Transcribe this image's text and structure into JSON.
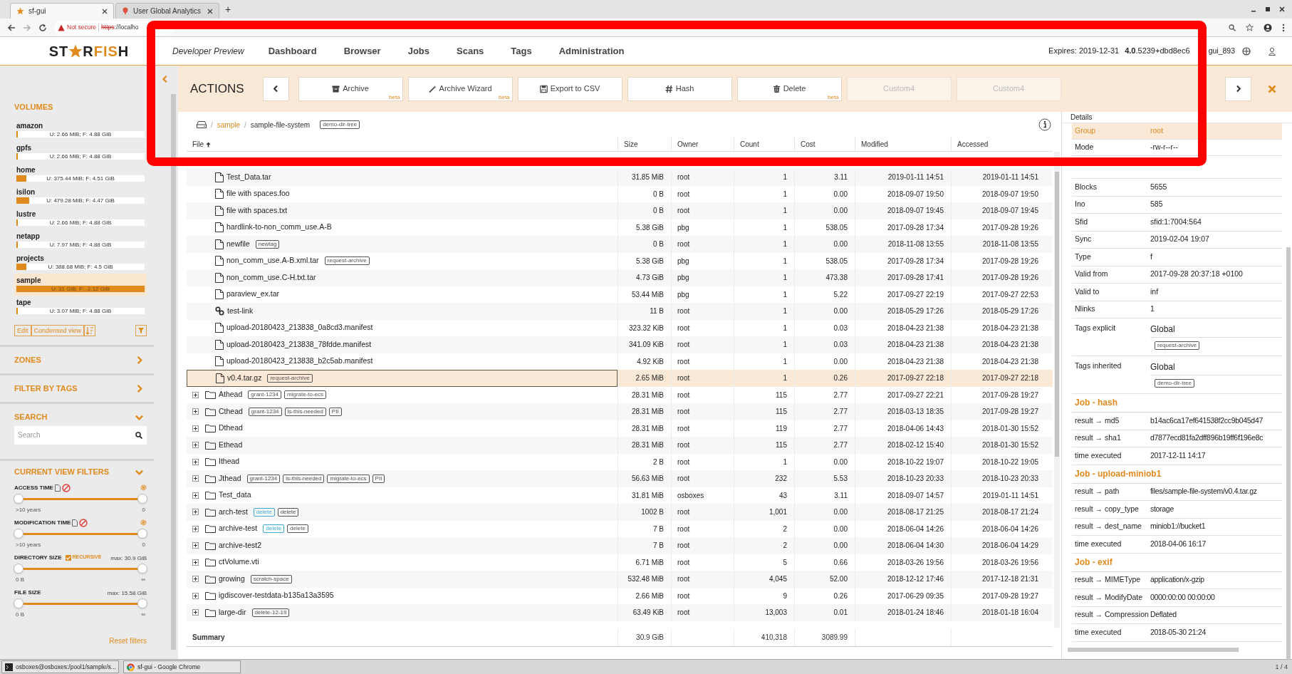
{
  "browser": {
    "tabs": [
      {
        "title": "sf-gui",
        "selected": true
      },
      {
        "title": "User Global Analytics",
        "selected": false
      }
    ],
    "new_tab": "+",
    "address": {
      "security": "Not secure",
      "scheme": "https",
      "rest": "://localho"
    }
  },
  "header": {
    "logo": {
      "before": "ST",
      "after": [
        {
          "text": "R",
          "accent": false
        },
        {
          "text": "FIS",
          "accent": true
        },
        {
          "text": "H",
          "accent": false
        }
      ]
    },
    "preview": "Developer Preview",
    "nav": [
      "Dashboard",
      "Browser",
      "Jobs",
      "Scans",
      "Tags",
      "Administration"
    ],
    "expires": "Expires: 2019-12-31",
    "version": "**4.0**.5239+dbd8ec6",
    "build": "gui_893"
  },
  "sidebar": {
    "volumes_title": "VOLUMES",
    "volumes": [
      {
        "name": "amazon",
        "usage": "U: 2.66 MiB; F: 4.88 GiB",
        "level": 0.005,
        "selected": false
      },
      {
        "name": "gpfs",
        "usage": "U: 2.66 MiB; F: 4.88 GiB",
        "level": 0.005,
        "selected": false
      },
      {
        "name": "home",
        "usage": "U: 375.44 MiB; F: 4.51 GiB",
        "level": 0.08,
        "selected": false
      },
      {
        "name": "isilon",
        "usage": "U: 479.28 MiB; F: 4.47 GiB",
        "level": 0.1,
        "selected": false
      },
      {
        "name": "lustre",
        "usage": "U: 2.66 MiB; F: 4.88 GiB",
        "level": 0.005,
        "selected": false
      },
      {
        "name": "netapp",
        "usage": "U: 7.97 MiB; F: 4.88 GiB",
        "level": 0.005,
        "selected": false
      },
      {
        "name": "projects",
        "usage": "U: 388.68 MiB; F: 4.5 GiB",
        "level": 0.08,
        "selected": false
      },
      {
        "name": "sample",
        "usage": "U: 31 GiB; F: -2.12 GiB",
        "level": 1,
        "selected": true
      },
      {
        "name": "tape",
        "usage": "U: 3.07 MiB; F: 4.88 GiB",
        "level": 0.005,
        "selected": false
      }
    ],
    "volume_buttons": [
      "Edit",
      "Condensed view"
    ],
    "sections": [
      {
        "title": "ZONES",
        "expanded": false
      },
      {
        "title": "FILTER BY TAGS",
        "expanded": false
      },
      {
        "title": "SEARCH",
        "expanded": true
      }
    ],
    "search": {
      "placeholder": "Search"
    },
    "filters_title": "CURRENT VIEW FILTERS",
    "filters_expanded": true,
    "filters": [
      {
        "kind": "time",
        "label": "ACCESS TIME",
        "level": 1,
        "min": ">10 years",
        "max": "0"
      },
      {
        "kind": "time",
        "label": "MODIFICATION TIME",
        "level": 1,
        "min": ">10 years",
        "max": "0"
      },
      {
        "kind": "size",
        "label": "DIRECTORY SIZE",
        "recursive": {
          "label": "RECURSIVE",
          "checked": true
        },
        "limit": "max: 30.9 GiB",
        "level": 1,
        "min": "0 B",
        "max": "∞"
      },
      {
        "kind": "size",
        "label": "FILE SIZE",
        "limit": "max: 15.58 GiB",
        "level": 1,
        "min": "0 B",
        "max": "∞"
      }
    ],
    "reset": "Reset filters"
  },
  "actions": {
    "title": "ACTIONS",
    "buttons": [
      {
        "kind": "archive",
        "label": "Archive",
        "badge": "beta",
        "disabled": false
      },
      {
        "kind": "wizard",
        "label": "Archive Wizard",
        "badge": "beta",
        "disabled": false
      },
      {
        "kind": "export",
        "label": "Export to CSV",
        "disabled": false
      },
      {
        "kind": "hash",
        "label": "Hash",
        "disabled": false
      },
      {
        "kind": "delete",
        "label": "Delete",
        "badge": "beta",
        "disabled": false
      },
      {
        "kind": "custom",
        "label": "Custom4",
        "disabled": true
      },
      {
        "kind": "custom",
        "label": "Custom4",
        "disabled": true
      }
    ]
  },
  "breadcrumb": {
    "sep": "/",
    "link": "sample",
    "current": "sample-file-system",
    "tag": "demo-dir-tree"
  },
  "table": {
    "columns": [
      "File",
      "Size",
      "Owner",
      "Count",
      "Cost",
      "Modified",
      "Accessed"
    ],
    "rows": [
      {
        "kind": "file",
        "name": "Test_Data.tar",
        "tags": [],
        "size": "31.85 MiB",
        "owner": "root",
        "count": "1",
        "cost": "3.11",
        "modified": "2019-01-11 14:51",
        "accessed": "2019-01-11 14:51",
        "selected": false
      },
      {
        "kind": "file",
        "name": "file with spaces.foo",
        "tags": [],
        "size": "0 B",
        "owner": "root",
        "count": "1",
        "cost": "0.00",
        "modified": "2018-09-07 19:50",
        "accessed": "2018-09-07 19:50",
        "selected": false
      },
      {
        "kind": "file",
        "name": "file with spaces.txt",
        "tags": [],
        "size": "0 B",
        "owner": "root",
        "count": "1",
        "cost": "0.00",
        "modified": "2018-09-07 19:45",
        "accessed": "2018-09-07 19:45",
        "selected": false
      },
      {
        "kind": "file",
        "name": "hardlink-to-non_comm_use.A-B",
        "tags": [],
        "size": "5.38 GiB",
        "owner": "pbg",
        "count": "1",
        "cost": "538.05",
        "modified": "2017-09-28 17:34",
        "accessed": "2017-09-28 19:26",
        "selected": false
      },
      {
        "kind": "file",
        "name": "newfile",
        "tags": [
          {
            "label": "newtag",
            "color": "#555555"
          }
        ],
        "size": "0 B",
        "owner": "root",
        "count": "1",
        "cost": "0.00",
        "modified": "2018-11-08 13:55",
        "accessed": "2018-11-08 13:55",
        "selected": false
      },
      {
        "kind": "file",
        "name": "non_comm_use.A-B.xml.tar",
        "tags": [
          {
            "label": "request-archive",
            "color": "#555555"
          }
        ],
        "size": "5.38 GiB",
        "owner": "pbg",
        "count": "1",
        "cost": "538.05",
        "modified": "2017-09-28 17:34",
        "accessed": "2017-09-28 19:26",
        "selected": false
      },
      {
        "kind": "file",
        "name": "non_comm_use.C-H.txt.tar",
        "tags": [],
        "size": "4.73 GiB",
        "owner": "pbg",
        "count": "1",
        "cost": "473.38",
        "modified": "2017-09-28 17:41",
        "accessed": "2017-09-28 19:26",
        "selected": false
      },
      {
        "kind": "file",
        "name": "paraview_ex.tar",
        "tags": [],
        "size": "53.44 MiB",
        "owner": "pbg",
        "count": "1",
        "cost": "5.22",
        "modified": "2017-09-27 22:19",
        "accessed": "2017-09-27 22:53",
        "selected": false
      },
      {
        "kind": "link",
        "name": "test-link",
        "tags": [],
        "size": "11 B",
        "owner": "root",
        "count": "1",
        "cost": "0.00",
        "modified": "2018-05-29 17:26",
        "accessed": "2018-05-29 17:26",
        "selected": false
      },
      {
        "kind": "file",
        "name": "upload-20180423_213838_0a8cd3.manifest",
        "tags": [],
        "size": "323.32 KiB",
        "owner": "root",
        "count": "1",
        "cost": "0.03",
        "modified": "2018-04-23 21:38",
        "accessed": "2018-04-23 21:38",
        "selected": false
      },
      {
        "kind": "file",
        "name": "upload-20180423_213838_78fdde.manifest",
        "tags": [],
        "size": "341.09 KiB",
        "owner": "root",
        "count": "1",
        "cost": "0.03",
        "modified": "2018-04-23 21:38",
        "accessed": "2018-04-23 21:38",
        "selected": false
      },
      {
        "kind": "file",
        "name": "upload-20180423_213838_b2c5ab.manifest",
        "tags": [],
        "size": "4.92 KiB",
        "owner": "root",
        "count": "1",
        "cost": "0.00",
        "modified": "2018-04-23 21:38",
        "accessed": "2018-04-23 21:38",
        "selected": false
      },
      {
        "kind": "file",
        "name": "v0.4.tar.gz",
        "tags": [
          {
            "label": "request-archive",
            "color": "#555555"
          }
        ],
        "size": "2.65 MiB",
        "owner": "root",
        "count": "1",
        "cost": "0.26",
        "modified": "2017-09-27 22:18",
        "accessed": "2017-09-27 22:18",
        "selected": true
      },
      {
        "kind": "folder",
        "name": "Athead",
        "tags": [
          {
            "label": "grant-1234",
            "color": "#555555"
          },
          {
            "label": "migrate-to-ecs",
            "color": "#555555"
          }
        ],
        "size": "28.31 MiB",
        "owner": "root",
        "count": "115",
        "cost": "2.77",
        "modified": "2017-09-27 22:21",
        "accessed": "2017-09-28 19:27",
        "selected": false
      },
      {
        "kind": "folder",
        "name": "Cthead",
        "tags": [
          {
            "label": "grant-1234",
            "color": "#555555"
          },
          {
            "label": "is-this-needed",
            "color": "#555555"
          },
          {
            "label": "PII",
            "color": "#555555"
          }
        ],
        "size": "28.31 MiB",
        "owner": "root",
        "count": "115",
        "cost": "2.77",
        "modified": "2018-03-13 18:35",
        "accessed": "2017-09-28 19:27",
        "selected": false
      },
      {
        "kind": "folder",
        "name": "Dthead",
        "tags": [],
        "size": "28.31 MiB",
        "owner": "root",
        "count": "119",
        "cost": "2.77",
        "modified": "2018-04-06 14:43",
        "accessed": "2018-01-30 15:52",
        "selected": false
      },
      {
        "kind": "folder",
        "name": "Ethead",
        "tags": [],
        "size": "28.31 MiB",
        "owner": "root",
        "count": "115",
        "cost": "2.77",
        "modified": "2018-02-12 15:40",
        "accessed": "2018-01-30 15:52",
        "selected": false
      },
      {
        "kind": "folder",
        "name": "Ithead",
        "tags": [],
        "size": "2 B",
        "owner": "root",
        "count": "1",
        "cost": "0.00",
        "modified": "2018-10-22 19:07",
        "accessed": "2018-10-22 19:05",
        "selected": false
      },
      {
        "kind": "folder",
        "name": "Jthead",
        "tags": [
          {
            "label": "grant-1234",
            "color": "#555555"
          },
          {
            "label": "is-this-needed",
            "color": "#555555"
          },
          {
            "label": "migrate-to-ecs",
            "color": "#555555"
          },
          {
            "label": "PII",
            "color": "#555555"
          }
        ],
        "size": "56.63 MiB",
        "owner": "root",
        "count": "232",
        "cost": "5.53",
        "modified": "2018-10-23 20:33",
        "accessed": "2018-10-23 20:33",
        "selected": false
      },
      {
        "kind": "folder",
        "name": "Test_data",
        "tags": [],
        "size": "31.81 MiB",
        "owner": "osboxes",
        "count": "43",
        "cost": "3.11",
        "modified": "2018-09-07 14:57",
        "accessed": "2019-01-11 14:51",
        "selected": false
      },
      {
        "kind": "folder",
        "name": "arch-test",
        "tags": [
          {
            "label": "delete",
            "color": "#3fa9d5"
          },
          {
            "label": "delete",
            "color": "#555555"
          }
        ],
        "size": "1002 B",
        "owner": "root",
        "count": "1,001",
        "cost": "0.00",
        "modified": "2018-08-17 21:25",
        "accessed": "2018-08-17 21:24",
        "selected": false
      },
      {
        "kind": "folder",
        "name": "archive-test",
        "tags": [
          {
            "label": "delete",
            "color": "#3fa9d5"
          },
          {
            "label": "delete",
            "color": "#555555"
          }
        ],
        "size": "7 B",
        "owner": "root",
        "count": "2",
        "cost": "0.00",
        "modified": "2018-06-04 14:26",
        "accessed": "2018-06-04 14:26",
        "selected": false
      },
      {
        "kind": "folder",
        "name": "archive-test2",
        "tags": [],
        "size": "7 B",
        "owner": "root",
        "count": "2",
        "cost": "0.00",
        "modified": "2018-06-04 14:30",
        "accessed": "2018-06-04 14:29",
        "selected": false
      },
      {
        "kind": "folder",
        "name": "ctVolume.vti",
        "tags": [],
        "size": "6.71 MiB",
        "owner": "root",
        "count": "5",
        "cost": "0.66",
        "modified": "2018-03-26 19:56",
        "accessed": "2018-03-26 19:56",
        "selected": false
      },
      {
        "kind": "folder",
        "name": "growing",
        "tags": [
          {
            "label": "scratch-space",
            "color": "#555555"
          }
        ],
        "size": "532.48 MiB",
        "owner": "root",
        "count": "4,045",
        "cost": "52.00",
        "modified": "2018-12-12 17:46",
        "accessed": "2017-12-18 21:31",
        "selected": false
      },
      {
        "kind": "folder",
        "name": "igdiscover-testdata-b135a13a3595",
        "tags": [],
        "size": "2.66 MiB",
        "owner": "root",
        "count": "9",
        "cost": "0.26",
        "modified": "2017-06-29 09:35",
        "accessed": "2017-09-28 19:27",
        "selected": false
      },
      {
        "kind": "folder",
        "name": "large-dir",
        "tags": [
          {
            "label": "delete-12-19",
            "color": "#555555"
          }
        ],
        "size": "63.49 KiB",
        "owner": "root",
        "count": "13,003",
        "cost": "0.01",
        "modified": "2018-01-24 18:46",
        "accessed": "2018-01-18 16:04",
        "selected": false
      }
    ],
    "summary": {
      "label": "Summary",
      "size": "30.9 GiB",
      "count": "410,318",
      "cost": "3089.99"
    }
  },
  "details": {
    "title": "Details",
    "rows": [
      {
        "kind": "pair",
        "key": "Group",
        "value": "root",
        "selected": true
      },
      {
        "kind": "pair",
        "key": "Mode",
        "value": "-rw-r--r--",
        "selected": false
      },
      {
        "kind": "pair",
        "key": "Blocks",
        "value": "5655",
        "selected": false
      },
      {
        "kind": "pair",
        "key": "Ino",
        "value": "585",
        "selected": false
      },
      {
        "kind": "pair",
        "key": "Sfid",
        "value": "sfid:1:7004:564",
        "selected": false
      },
      {
        "kind": "pair",
        "key": "Sync",
        "value": "2019-02-04 19:07",
        "selected": false
      },
      {
        "kind": "pair",
        "key": "Type",
        "value": "f",
        "selected": false
      },
      {
        "kind": "pair",
        "key": "Valid from",
        "value": "2017-09-28 20:37:18 +0100",
        "selected": false
      },
      {
        "kind": "pair",
        "key": "Valid to",
        "value": "inf",
        "selected": false
      },
      {
        "kind": "pair",
        "key": "Nlinks",
        "value": "1",
        "selected": false
      },
      {
        "kind": "tags",
        "key": "Tags explicit",
        "value": "Global",
        "tag": "request-archive",
        "selected": false
      },
      {
        "kind": "tags",
        "key": "Tags inherited",
        "value": "Global",
        "tag": "demo-dir-tree",
        "selected": false
      }
    ],
    "jobs": [
      {
        "title": "Job - hash",
        "rows": [
          {
            "key": "result → md5",
            "value": "b14ac6ca17ef641538f2cc9b045d47"
          },
          {
            "key": "result → sha1",
            "value": "d7877ecd81fa2dff896b19ff6f196e8c"
          },
          {
            "key": "time executed",
            "value": "2017-12-11 14:17"
          }
        ]
      },
      {
        "title": "Job - upload-miniob1",
        "rows": [
          {
            "key": "result → path",
            "value": "files/sample-file-system/v0.4.tar.gz"
          },
          {
            "key": "result → copy_type",
            "value": "storage"
          },
          {
            "key": "result → dest_name",
            "value": "miniob1://bucket1"
          },
          {
            "key": "time executed",
            "value": "2018-04-06 16:17"
          }
        ]
      },
      {
        "title": "Job - exif",
        "rows": [
          {
            "key": "result → MIMEType",
            "value": "application/x-gzip"
          },
          {
            "key": "result → ModifyDate",
            "value": "0000:00:00 00:00:00"
          },
          {
            "key": "result → Compression",
            "value": "Deflated"
          },
          {
            "key": "time executed",
            "value": "2018-05-30 21:24"
          }
        ]
      }
    ]
  },
  "page_counter": "1 / 4",
  "taskbar": [
    "osboxes@osboxes:/pool1/sample/s...",
    "sf-gui - Google Chrome"
  ]
}
